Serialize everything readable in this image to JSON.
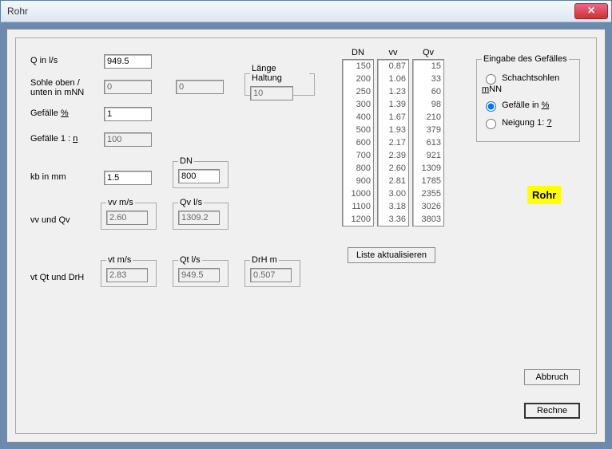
{
  "window": {
    "title": "Rohr"
  },
  "labels": {
    "q": "Q in l/s",
    "sohle": "Sohle oben / unten in mNN",
    "gefpct_pre": "Gefälle ",
    "gefpct_pct": "%",
    "gef1n_pre": "Gefälle 1 : ",
    "gef1n_n": "n",
    "kb": "kb in mm",
    "dn": "DN",
    "laenge": "Länge Haltung",
    "vv": "vv m/s",
    "qvls": "Qv l/s",
    "vvqv": "vv und Qv",
    "vt": "vt m/s",
    "qtls": "Qt l/s",
    "drh": "DrH m",
    "vtqtdrh": "vt Qt und DrH"
  },
  "values": {
    "q": "949.5",
    "sohle_oben": "0",
    "sohle_unten": "0",
    "gefpct": "1",
    "gef1n": "100",
    "kb": "1.5",
    "dn": "800",
    "laenge": "10",
    "vv": "2.60",
    "qv": "1309.2",
    "vt": "2.83",
    "qt": "949.5",
    "drh": "0.507"
  },
  "table": {
    "head_dn": "DN",
    "head_vv": "vv",
    "head_qv": "Qv",
    "dn": [
      "150",
      "200",
      "250",
      "300",
      "400",
      "500",
      "600",
      "700",
      "800",
      "900",
      "1000",
      "1100",
      "1200"
    ],
    "vv": [
      "0.87",
      "1.06",
      "1.23",
      "1.39",
      "1.67",
      "1.93",
      "2.17",
      "2.39",
      "2.60",
      "2.81",
      "3.00",
      "3.18",
      "3.36"
    ],
    "qv": [
      "15",
      "33",
      "60",
      "98",
      "210",
      "379",
      "613",
      "921",
      "1309",
      "1785",
      "2355",
      "3026",
      "3803"
    ]
  },
  "buttons": {
    "liste": "Liste aktualisieren",
    "abbruch": "Abbruch",
    "rechne": "Rechne"
  },
  "radio": {
    "legend": "Eingabe des Gefälles",
    "schacht_pre": "Schachtsohlen ",
    "schacht_u": "m",
    "schacht_post": "NN",
    "gef_pre": "Gefälle in ",
    "gef_u": "%",
    "neig_pre": "Neigung 1: ",
    "neig_u": "?"
  },
  "badge": "Rohr"
}
